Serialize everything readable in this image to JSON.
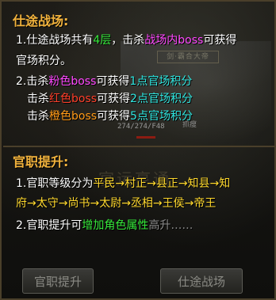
{
  "background": {
    "plaque": "剑·霸合大帝",
    "hp": "274/274/F48",
    "name": "抓瘦",
    "watermark": "官运亨通"
  },
  "section1": {
    "title": "仕途战场:",
    "l1": {
      "a": "1.仕途战场共有",
      "b": "4层",
      "c": "，击杀",
      "d": "战场内boss",
      "e": "可获得"
    },
    "l2": "官场积分。",
    "l3": {
      "a": "2.击杀",
      "b": "粉色boss",
      "c": "可获得",
      "d": "1点官场积分"
    },
    "l4": {
      "a": "击杀",
      "b": "红色boss",
      "c": "可获得",
      "d": "2点官场积分"
    },
    "l5": {
      "a": "击杀",
      "b": "橙色boss",
      "c": "可获得",
      "d": "5点官场积分"
    }
  },
  "section2": {
    "title": "官职提升:",
    "l1": {
      "a": "1.官职等级分为",
      "b": "平民→村正→县正→知县→知"
    },
    "l2": "府→太守→尚书→太尉→丞相→王侯→帝王",
    "l3": {
      "a": "2.官职提升可",
      "b": "增加角色属性",
      "c": "高升……"
    }
  },
  "buttons": {
    "promote": "官职提升",
    "battlefield": "仕途战场"
  },
  "colors": {
    "title": "#f2b33d",
    "green": "#35e83a",
    "pink": "#ff48ff",
    "cyan": "#2fe6e0",
    "red": "#ff3f2a",
    "orange": "#ff9a17",
    "yellow": "#ffd92e"
  }
}
